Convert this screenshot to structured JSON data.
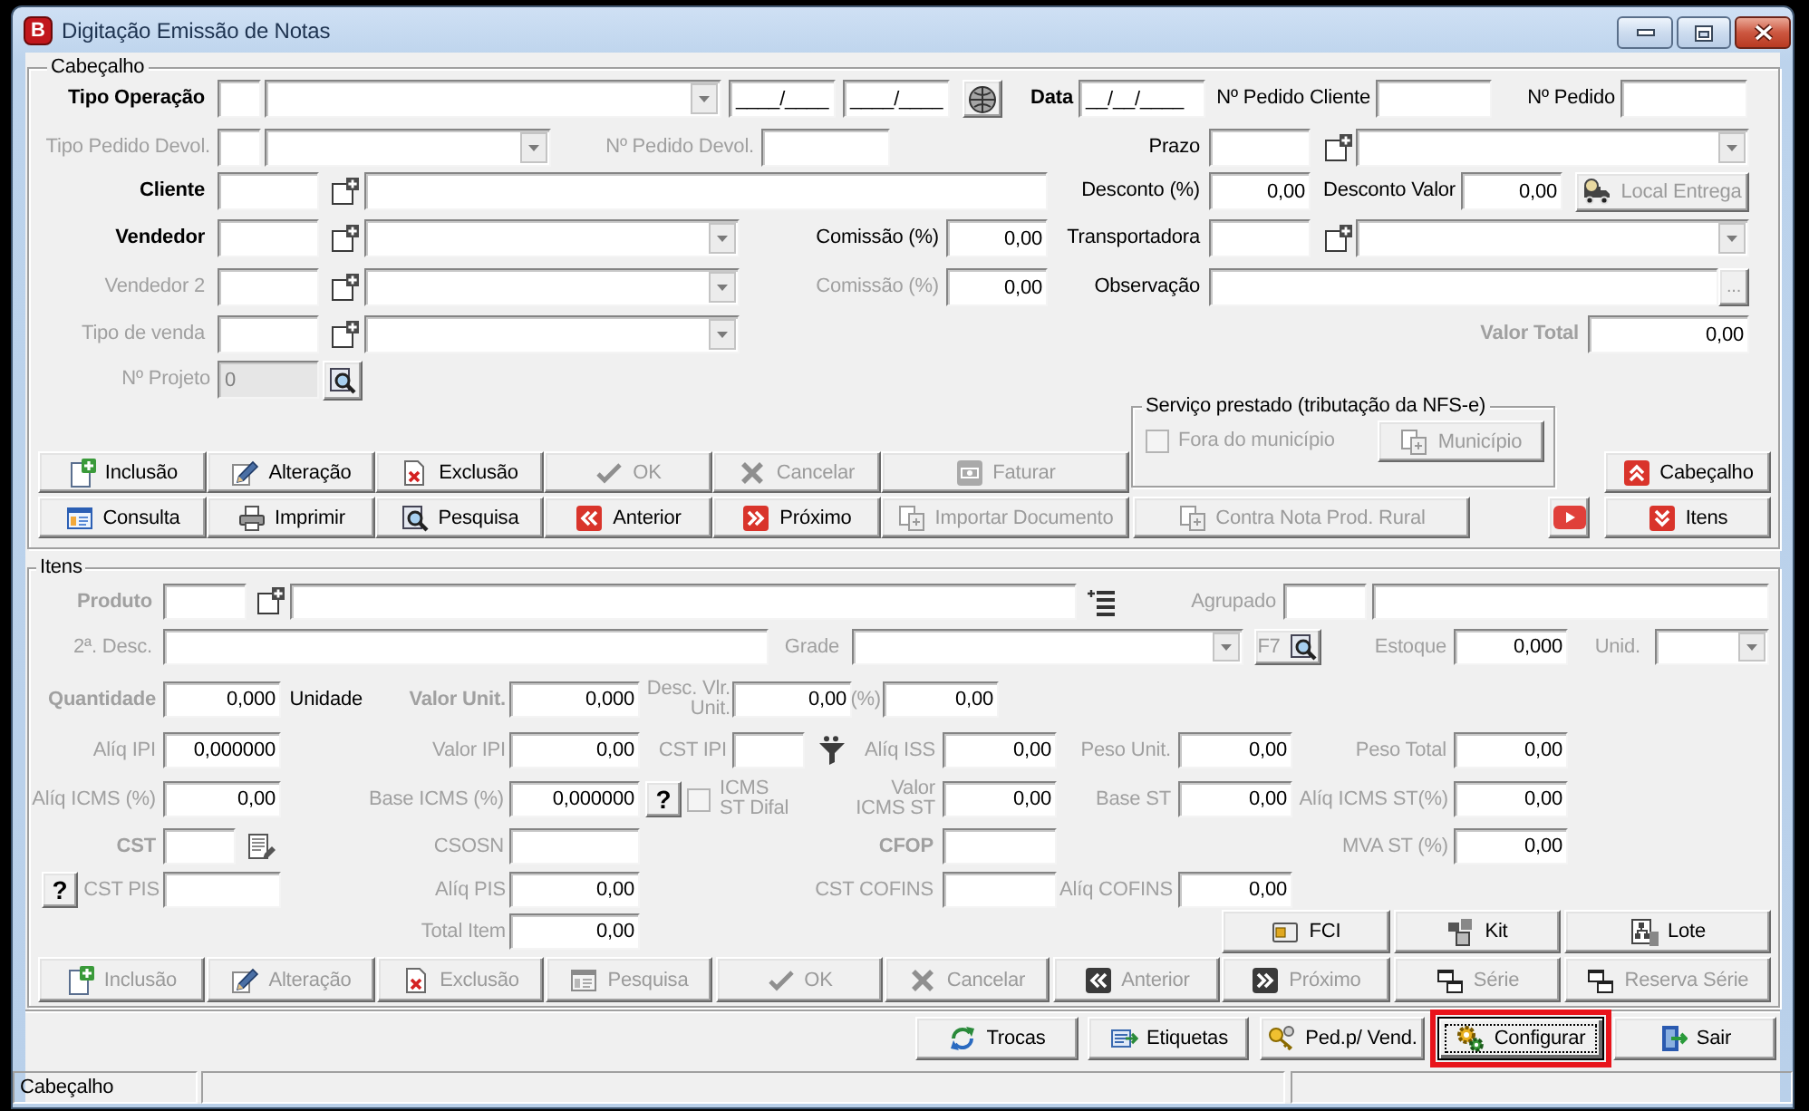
{
  "window": {
    "icon_letter": "B",
    "title": "Digitação Emissão de Notas"
  },
  "header": {
    "title": "Cabeçalho",
    "lines": [
      {
        "items": [
          {
            "kind": "label",
            "text": "Tipo Operação",
            "bold": true,
            "disabled": false
          },
          {
            "kind": "field",
            "disabled": false
          },
          {
            "kind": "combo"
          },
          {
            "kind": "field",
            "value": "____/____",
            "disabled": false
          },
          {
            "kind": "field",
            "value": "____/____",
            "disabled": false
          },
          {
            "kind": "globe_button"
          },
          {
            "kind": "label",
            "text": "Data",
            "bold": true,
            "disabled": false
          },
          {
            "kind": "field",
            "value": "__/__/____",
            "disabled": false
          },
          {
            "kind": "label",
            "text": "Nº Pedido Cliente",
            "bold": false,
            "disabled": false
          },
          {
            "kind": "field",
            "disabled": false
          },
          {
            "kind": "label",
            "text": "Nº Pedido",
            "bold": false,
            "disabled": false
          },
          {
            "kind": "field",
            "disabled": false
          }
        ]
      },
      {
        "items": [
          {
            "kind": "label",
            "text": "Tipo Pedido Devol.",
            "bold": false,
            "disabled": true
          },
          {
            "kind": "field",
            "disabled": false
          },
          {
            "kind": "combo"
          },
          {
            "kind": "label",
            "text": "Nº Pedido Devol.",
            "bold": false,
            "disabled": true
          },
          {
            "kind": "field",
            "disabled": false
          },
          {
            "kind": "label",
            "text": "Prazo",
            "bold": false,
            "disabled": false
          },
          {
            "kind": "field",
            "disabled": false
          },
          {
            "kind": "lookup"
          },
          {
            "kind": "combo"
          }
        ]
      },
      {
        "items": [
          {
            "kind": "label",
            "text": "Cliente",
            "bold": true,
            "disabled": false
          },
          {
            "kind": "field",
            "disabled": false
          },
          {
            "kind": "lookup"
          },
          {
            "kind": "field",
            "disabled": false
          },
          {
            "kind": "label",
            "text": "Desconto (%)",
            "bold": false,
            "disabled": false
          },
          {
            "kind": "field",
            "value": "0,00",
            "disabled": false
          },
          {
            "kind": "label",
            "text": "Desconto Valor",
            "bold": false,
            "disabled": false
          },
          {
            "kind": "field",
            "value": "0,00",
            "disabled": false
          },
          {
            "kind": "button",
            "label": "Local Entrega",
            "disabled": true
          }
        ]
      },
      {
        "items": [
          {
            "kind": "label",
            "text": "Vendedor",
            "bold": true,
            "disabled": false
          },
          {
            "kind": "field",
            "disabled": false
          },
          {
            "kind": "lookup"
          },
          {
            "kind": "combo"
          },
          {
            "kind": "label",
            "text": "Comissão (%)",
            "bold": false,
            "disabled": false
          },
          {
            "kind": "field",
            "value": "0,00",
            "disabled": false
          },
          {
            "kind": "label",
            "text": "Transportadora",
            "bold": false,
            "disabled": false
          },
          {
            "kind": "field",
            "disabled": false
          },
          {
            "kind": "lookup"
          },
          {
            "kind": "combo"
          }
        ]
      },
      {
        "items": [
          {
            "kind": "label",
            "text": "Vendedor 2",
            "bold": false,
            "disabled": true
          },
          {
            "kind": "field",
            "disabled": false
          },
          {
            "kind": "lookup"
          },
          {
            "kind": "combo"
          },
          {
            "kind": "label",
            "text": "Comissão (%)",
            "bold": false,
            "disabled": true
          },
          {
            "kind": "field",
            "value": "0,00",
            "disabled": false
          },
          {
            "kind": "label",
            "text": "Observação",
            "bold": false,
            "disabled": false
          },
          {
            "kind": "field",
            "disabled": false
          },
          {
            "kind": "ellipsis_button",
            "label": "...",
            "disabled": true
          }
        ]
      },
      {
        "items": [
          {
            "kind": "label",
            "text": "Tipo de venda",
            "bold": false,
            "disabled": true
          },
          {
            "kind": "field",
            "disabled": false
          },
          {
            "kind": "lookup"
          },
          {
            "kind": "combo"
          },
          {
            "kind": "label",
            "text": "Valor Total",
            "bold": true,
            "disabled": true
          },
          {
            "kind": "field",
            "value": "0,00",
            "disabled": false
          }
        ]
      },
      {
        "items": [
          {
            "kind": "label",
            "text": "Nº Projeto",
            "bold": false,
            "disabled": true
          },
          {
            "kind": "field",
            "value": "0",
            "disabled": true
          },
          {
            "kind": "search_button"
          }
        ]
      }
    ],
    "service": {
      "title": "Serviço prestado (tributação da NFS-e)",
      "checkbox": {
        "label": "Fora do município",
        "checked": false,
        "disabled": true
      },
      "button": {
        "label": "Município",
        "disabled": true
      }
    },
    "record_buttons": [
      {
        "label": "Inclusão",
        "disabled": false
      },
      {
        "label": "Alteração",
        "disabled": false
      },
      {
        "label": "Exclusão",
        "disabled": false
      },
      {
        "label": "OK",
        "disabled": true
      },
      {
        "label": "Cancelar",
        "disabled": true
      },
      {
        "label": "Faturar",
        "disabled": true
      },
      {
        "label": "Consulta",
        "disabled": false
      },
      {
        "label": "Imprimir",
        "disabled": false
      },
      {
        "label": "Pesquisa",
        "disabled": false
      },
      {
        "label": "Anterior",
        "disabled": false
      },
      {
        "label": "Próximo",
        "disabled": false
      },
      {
        "label": "Importar Documento",
        "disabled": true
      }
    ],
    "rural_button": {
      "label": "Contra Nota Prod. Rural",
      "disabled": true
    },
    "section_buttons": [
      {
        "label": "Cabeçalho",
        "disabled": false
      },
      {
        "label": "Itens",
        "disabled": false
      }
    ]
  },
  "items": {
    "title": "Itens",
    "lines": [
      {
        "items": [
          {
            "kind": "label",
            "text": "Produto",
            "bold": true,
            "disabled": true
          },
          {
            "kind": "field",
            "disabled": false
          },
          {
            "kind": "lookup"
          },
          {
            "kind": "field",
            "disabled": false
          },
          {
            "kind": "list_icon"
          },
          {
            "kind": "label",
            "text": "Agrupado",
            "bold": false,
            "disabled": true
          },
          {
            "kind": "field",
            "disabled": false
          },
          {
            "kind": "field",
            "disabled": false
          }
        ]
      },
      {
        "items": [
          {
            "kind": "label",
            "text": "2ª. Desc.",
            "bold": false,
            "disabled": true
          },
          {
            "kind": "field",
            "disabled": false
          },
          {
            "kind": "label",
            "text": "Grade",
            "bold": false,
            "disabled": true
          },
          {
            "kind": "combo"
          },
          {
            "kind": "button",
            "label": "F7",
            "disabled": true
          },
          {
            "kind": "label",
            "text": "Estoque",
            "bold": false,
            "disabled": true
          },
          {
            "kind": "field",
            "value": "0,000",
            "disabled": false
          },
          {
            "kind": "label",
            "text": "Unid.",
            "bold": false,
            "disabled": true
          },
          {
            "kind": "combo"
          }
        ]
      },
      {
        "items": [
          {
            "kind": "label",
            "text": "Quantidade",
            "bold": true,
            "disabled": true
          },
          {
            "kind": "field",
            "value": "0,000",
            "disabled": false
          },
          {
            "kind": "label",
            "text": "Unidade",
            "bold": false,
            "disabled": false
          },
          {
            "kind": "label",
            "text": "Valor Unit.",
            "bold": true,
            "disabled": true
          },
          {
            "kind": "field",
            "value": "0,000",
            "disabled": false
          },
          {
            "kind": "label",
            "text": "Desc. Vlr. Unit.",
            "bold": false,
            "disabled": true
          },
          {
            "kind": "field",
            "value": "0,00",
            "disabled": false
          },
          {
            "kind": "label",
            "text": "(%)",
            "bold": false,
            "disabled": true
          },
          {
            "kind": "field",
            "value": "0,00",
            "disabled": false
          }
        ]
      },
      {
        "items": [
          {
            "kind": "label",
            "text": "Alíq IPI",
            "bold": false,
            "disabled": true
          },
          {
            "kind": "field",
            "value": "0,000000",
            "disabled": false
          },
          {
            "kind": "label",
            "text": "Valor IPI",
            "bold": false,
            "disabled": true
          },
          {
            "kind": "field",
            "value": "0,00",
            "disabled": false
          },
          {
            "kind": "label",
            "text": "CST IPI",
            "bold": false,
            "disabled": true
          },
          {
            "kind": "field",
            "disabled": false
          },
          {
            "kind": "funnel_icon"
          },
          {
            "kind": "label",
            "text": "Alíq ISS",
            "bold": false,
            "disabled": true
          },
          {
            "kind": "field",
            "value": "0,00",
            "disabled": false
          },
          {
            "kind": "label",
            "text": "Peso Unit.",
            "bold": false,
            "disabled": true
          },
          {
            "kind": "field",
            "value": "0,00",
            "disabled": false
          },
          {
            "kind": "label",
            "text": "Peso Total",
            "bold": false,
            "disabled": true
          },
          {
            "kind": "field",
            "value": "0,00",
            "disabled": false
          }
        ]
      },
      {
        "items": [
          {
            "kind": "label",
            "text": "Alíq ICMS (%)",
            "bold": false,
            "disabled": true
          },
          {
            "kind": "field",
            "value": "0,00",
            "disabled": false
          },
          {
            "kind": "label",
            "text": "Base ICMS (%)",
            "bold": false,
            "disabled": true
          },
          {
            "kind": "field",
            "value": "0,000000",
            "disabled": false
          },
          {
            "kind": "help_button",
            "label": "?"
          },
          {
            "kind": "checkbox",
            "label": "ICMS ST Difal",
            "checked": false,
            "disabled": true
          },
          {
            "kind": "label",
            "text": "Valor ICMS ST",
            "bold": false,
            "disabled": true
          },
          {
            "kind": "field",
            "value": "0,00",
            "disabled": false
          },
          {
            "kind": "label",
            "text": "Base ST",
            "bold": false,
            "disabled": true
          },
          {
            "kind": "field",
            "value": "0,00",
            "disabled": false
          },
          {
            "kind": "label",
            "text": "Alíq ICMS ST(%)",
            "bold": false,
            "disabled": true
          },
          {
            "kind": "field",
            "value": "0,00",
            "disabled": false
          }
        ]
      },
      {
        "items": [
          {
            "kind": "label",
            "text": "CST",
            "bold": true,
            "disabled": true
          },
          {
            "kind": "field",
            "disabled": false
          },
          {
            "kind": "edit_icon"
          },
          {
            "kind": "label",
            "text": "CSOSN",
            "bold": false,
            "disabled": true
          },
          {
            "kind": "field",
            "disabled": false
          },
          {
            "kind": "label",
            "text": "CFOP",
            "bold": true,
            "disabled": true
          },
          {
            "kind": "field",
            "disabled": false
          },
          {
            "kind": "label",
            "text": "MVA ST (%)",
            "bold": false,
            "disabled": true
          },
          {
            "kind": "field",
            "value": "0,00",
            "disabled": false
          }
        ]
      },
      {
        "items": [
          {
            "kind": "help_button",
            "label": "?"
          },
          {
            "kind": "label",
            "text": "CST PIS",
            "bold": false,
            "disabled": true
          },
          {
            "kind": "field",
            "disabled": false
          },
          {
            "kind": "label",
            "text": "Alíq PIS",
            "bold": false,
            "disabled": true
          },
          {
            "kind": "field",
            "value": "0,00",
            "disabled": false
          },
          {
            "kind": "label",
            "text": "CST COFINS",
            "bold": false,
            "disabled": true
          },
          {
            "kind": "field",
            "disabled": false
          },
          {
            "kind": "label",
            "text": "Alíq COFINS",
            "bold": false,
            "disabled": true
          },
          {
            "kind": "field",
            "value": "0,00",
            "disabled": false
          }
        ]
      },
      {
        "items": [
          {
            "kind": "label",
            "text": "Total Item",
            "bold": false,
            "disabled": true
          },
          {
            "kind": "field",
            "value": "0,00",
            "disabled": false
          },
          {
            "kind": "button",
            "label": "FCI",
            "disabled": false
          },
          {
            "kind": "button",
            "label": "Kit",
            "disabled": false
          },
          {
            "kind": "button",
            "label": "Lote",
            "disabled": false
          }
        ]
      }
    ],
    "record_buttons": [
      {
        "label": "Inclusão",
        "disabled": true
      },
      {
        "label": "Alteração",
        "disabled": true
      },
      {
        "label": "Exclusão",
        "disabled": true
      },
      {
        "label": "Pesquisa",
        "disabled": true
      },
      {
        "label": "OK",
        "disabled": true
      },
      {
        "label": "Cancelar",
        "disabled": true
      },
      {
        "label": "Anterior",
        "disabled": true
      },
      {
        "label": "Próximo",
        "disabled": true
      },
      {
        "label": "Série",
        "disabled": true
      },
      {
        "label": "Reserva Série",
        "disabled": true
      }
    ]
  },
  "footer_buttons": [
    {
      "label": "Trocas",
      "focused": false,
      "highlighted": false
    },
    {
      "label": "Etiquetas",
      "focused": false,
      "highlighted": false
    },
    {
      "label": "Ped.p/ Vend.",
      "focused": false,
      "highlighted": false
    },
    {
      "label": "Configurar",
      "focused": true,
      "highlighted": true
    },
    {
      "label": "Sair",
      "focused": false,
      "highlighted": false
    }
  ],
  "status_bar": {
    "text": "Cabeçalho"
  }
}
